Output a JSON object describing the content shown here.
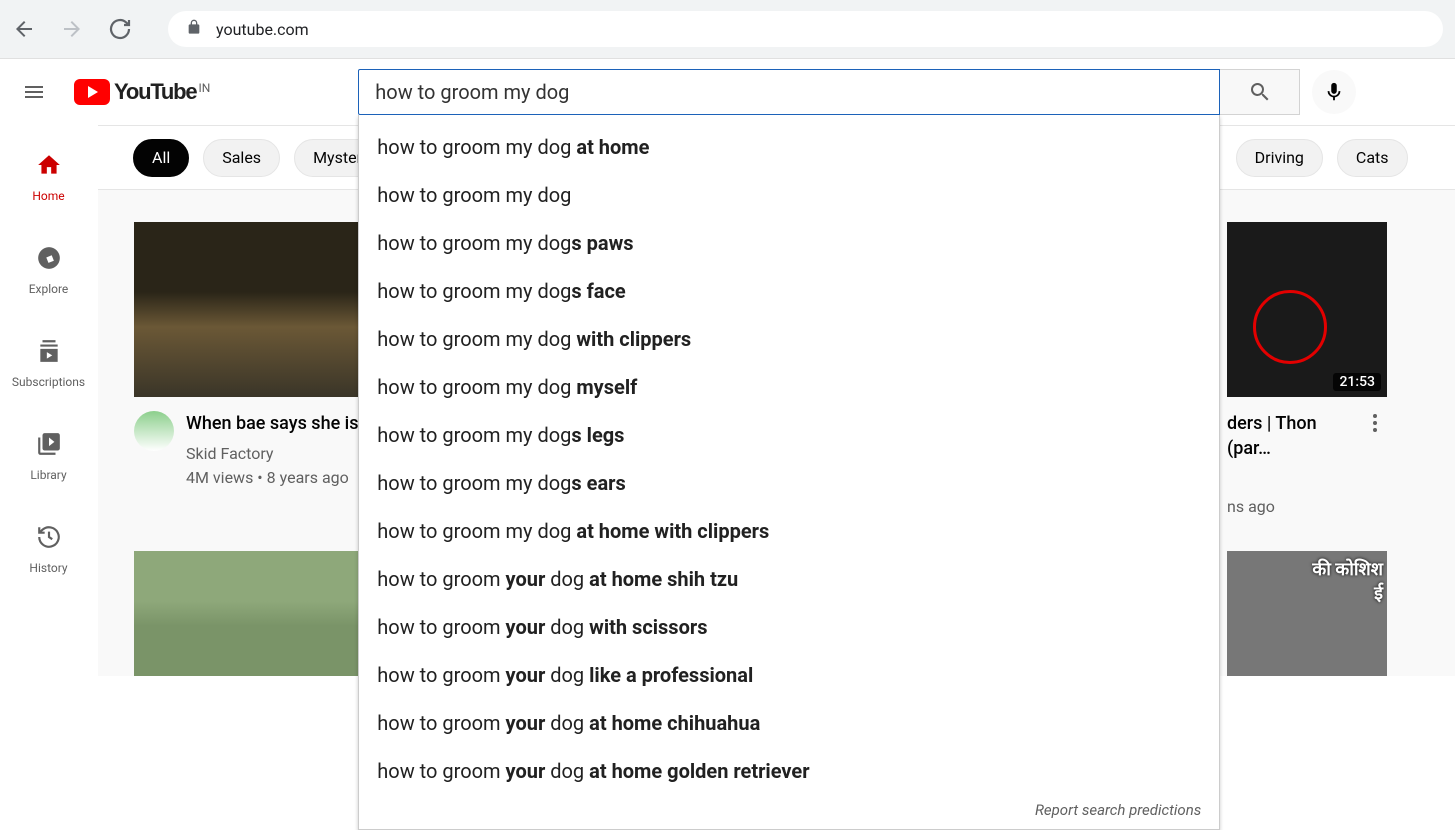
{
  "browser": {
    "url": "youtube.com"
  },
  "logo": {
    "text": "YouTube",
    "region": "IN"
  },
  "search": {
    "value": "how to groom my dog",
    "report": "Report search predictions",
    "suggestions": [
      [
        {
          "t": "how to groom my dog ",
          "b": false
        },
        {
          "t": "at home",
          "b": true
        }
      ],
      [
        {
          "t": "how to groom my dog",
          "b": false
        }
      ],
      [
        {
          "t": "how to groom my dog",
          "b": false
        },
        {
          "t": "s paws",
          "b": true
        }
      ],
      [
        {
          "t": "how to groom my dog",
          "b": false
        },
        {
          "t": "s face",
          "b": true
        }
      ],
      [
        {
          "t": "how to groom my dog ",
          "b": false
        },
        {
          "t": "with clippers",
          "b": true
        }
      ],
      [
        {
          "t": "how to groom my dog ",
          "b": false
        },
        {
          "t": "myself",
          "b": true
        }
      ],
      [
        {
          "t": "how to groom my dog",
          "b": false
        },
        {
          "t": "s legs",
          "b": true
        }
      ],
      [
        {
          "t": "how to groom my dog",
          "b": false
        },
        {
          "t": "s ears",
          "b": true
        }
      ],
      [
        {
          "t": "how to groom my dog ",
          "b": false
        },
        {
          "t": "at home with clippers",
          "b": true
        }
      ],
      [
        {
          "t": "how to groom ",
          "b": false
        },
        {
          "t": "your",
          "b": true
        },
        {
          "t": " dog ",
          "b": false
        },
        {
          "t": "at home shih tzu",
          "b": true
        }
      ],
      [
        {
          "t": "how to groom ",
          "b": false
        },
        {
          "t": "your",
          "b": true
        },
        {
          "t": " dog ",
          "b": false
        },
        {
          "t": "with scissors",
          "b": true
        }
      ],
      [
        {
          "t": "how to groom ",
          "b": false
        },
        {
          "t": "your",
          "b": true
        },
        {
          "t": " dog ",
          "b": false
        },
        {
          "t": "like a professional",
          "b": true
        }
      ],
      [
        {
          "t": "how to groom ",
          "b": false
        },
        {
          "t": "your",
          "b": true
        },
        {
          "t": " dog ",
          "b": false
        },
        {
          "t": "at home chihuahua",
          "b": true
        }
      ],
      [
        {
          "t": "how to groom ",
          "b": false
        },
        {
          "t": "your",
          "b": true
        },
        {
          "t": " dog ",
          "b": false
        },
        {
          "t": "at home golden retriever",
          "b": true
        }
      ]
    ]
  },
  "rail": [
    {
      "label": "Home",
      "active": true
    },
    {
      "label": "Explore",
      "active": false
    },
    {
      "label": "Subscriptions",
      "active": false
    },
    {
      "label": "Library",
      "active": false
    },
    {
      "label": "History",
      "active": false
    }
  ],
  "chips": [
    "All",
    "Sales",
    "Mysteries",
    "Driving",
    "Cats"
  ],
  "videos": {
    "v1": {
      "title": "When bae says she is alone",
      "channel": "Skid Factory",
      "meta": "4M views • 8 years ago"
    },
    "v2": {
      "title": "ders | Thon (par…",
      "meta": "ns ago",
      "duration": "21:53"
    },
    "v3": {
      "overlay": "की कोशिश\nई"
    }
  }
}
